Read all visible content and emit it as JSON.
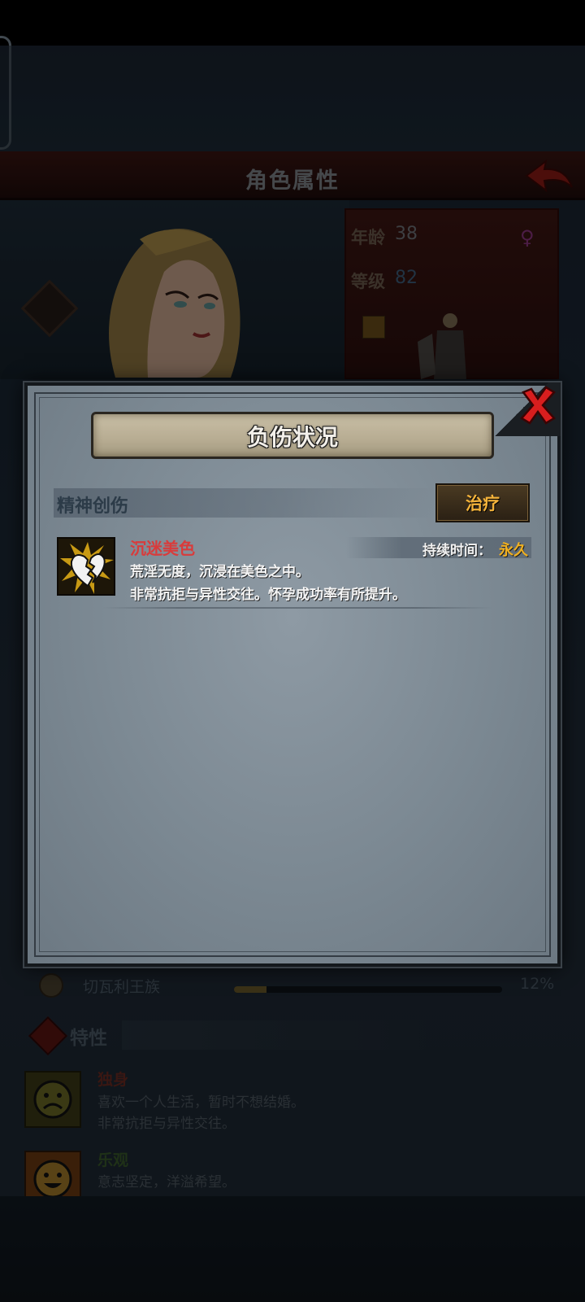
{
  "screen": {
    "title": "角色属性",
    "age_label": "年龄",
    "age_value": "38",
    "level_label": "等级",
    "level_value": "82",
    "gender_symbol": "♀",
    "faction": {
      "name": "切瓦利王族",
      "percent_text": "12%",
      "progress": 0.12
    },
    "traits_heading": "特性",
    "traits": [
      {
        "name": "独身",
        "desc_lines": [
          "喜欢一个人生活，暂时不想结婚。",
          "非常抗拒与异性交往。"
        ],
        "icon": "sad-face-icon"
      },
      {
        "name": "乐观",
        "desc_lines": [
          "意志坚定，洋溢希望。"
        ],
        "icon": "happy-face-icon"
      }
    ]
  },
  "modal": {
    "title": "负伤状况",
    "section_label": "精神创伤",
    "heal_button": "治疗",
    "injury": {
      "name": "沉迷美色",
      "duration_label": "持续时间：",
      "duration_value": "永久",
      "desc_lines": [
        "荒淫无度，沉浸在美色之中。",
        "非常抗拒与异性交往。怀孕成功率有所提升。"
      ],
      "icon": "broken-heart-icon"
    }
  },
  "colors": {
    "injury_name": "#d93b3b",
    "duration_value": "#f0b020",
    "heal_label": "#f3b23a",
    "close_x": "#d81e1e"
  }
}
